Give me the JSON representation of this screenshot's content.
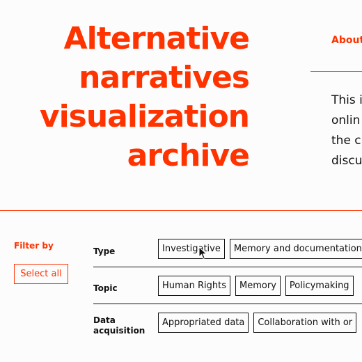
{
  "header": {
    "title_lines": [
      "Alternative",
      "narratives",
      "visualization",
      "archive"
    ],
    "about_label": "About",
    "intro_lines": [
      "This i",
      "onlin",
      "the c",
      "discu"
    ]
  },
  "filters": {
    "heading": "Filter by",
    "select_all_label": "Select all",
    "rows": [
      {
        "label": "Type",
        "tags": [
          "Investigative",
          "Memory and documentation"
        ]
      },
      {
        "label": "Topic",
        "tags": [
          "Human Rights",
          "Memory",
          "Policymaking"
        ]
      },
      {
        "label_lines": [
          "Data",
          "acquisition"
        ],
        "tags": [
          "Appropriated data",
          "Collaboration with or"
        ]
      }
    ]
  },
  "colors": {
    "accent": "#ff3300",
    "text": "#111111",
    "background": "#fcfcfc"
  },
  "icons": {
    "cursor": "mouse-pointer-icon"
  }
}
